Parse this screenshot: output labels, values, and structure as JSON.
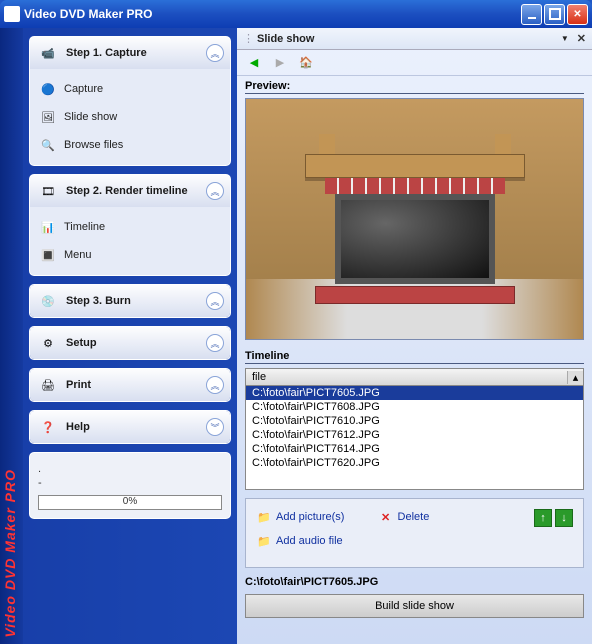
{
  "window": {
    "title": "Video DVD Maker PRO",
    "vertical_text": "Video DVD Maker PRO"
  },
  "sidebar": {
    "panels": [
      {
        "id": "capture",
        "label": "Step 1. Capture",
        "expanded": true,
        "chevron": "up",
        "items": [
          {
            "id": "capture-item",
            "label": "Capture"
          },
          {
            "id": "slideshow-item",
            "label": "Slide show"
          },
          {
            "id": "browse-item",
            "label": "Browse files"
          }
        ]
      },
      {
        "id": "render",
        "label": "Step 2. Render timeline",
        "expanded": true,
        "chevron": "up",
        "items": [
          {
            "id": "timeline-item",
            "label": "Timeline"
          },
          {
            "id": "menu-item",
            "label": "Menu"
          }
        ]
      },
      {
        "id": "burn",
        "label": "Step 3. Burn",
        "expanded": false,
        "chevron": "up",
        "items": []
      },
      {
        "id": "setup",
        "label": "Setup",
        "expanded": false,
        "chevron": "up",
        "items": []
      },
      {
        "id": "print",
        "label": "Print",
        "expanded": false,
        "chevron": "up",
        "items": []
      },
      {
        "id": "help",
        "label": "Help",
        "expanded": false,
        "chevron": "down",
        "items": []
      }
    ],
    "status": {
      "line1": ".",
      "line2": "-",
      "progress_text": "0%"
    }
  },
  "main": {
    "tab_title": "Slide show",
    "preview_label": "Preview:",
    "timeline_label": "Timeline",
    "file_header": "file",
    "files": [
      "C:\\foto\\fair\\PICT7605.JPG",
      "C:\\foto\\fair\\PICT7608.JPG",
      "C:\\foto\\fair\\PICT7610.JPG",
      "C:\\foto\\fair\\PICT7612.JPG",
      "C:\\foto\\fair\\PICT7614.JPG",
      "C:\\foto\\fair\\PICT7620.JPG"
    ],
    "selected_index": 0,
    "actions": {
      "add_pictures": "Add picture(s)",
      "delete": "Delete",
      "add_audio": "Add audio file"
    },
    "current_file": "C:\\foto\\fair\\PICT7605.JPG",
    "build_button": "Build slide show"
  }
}
